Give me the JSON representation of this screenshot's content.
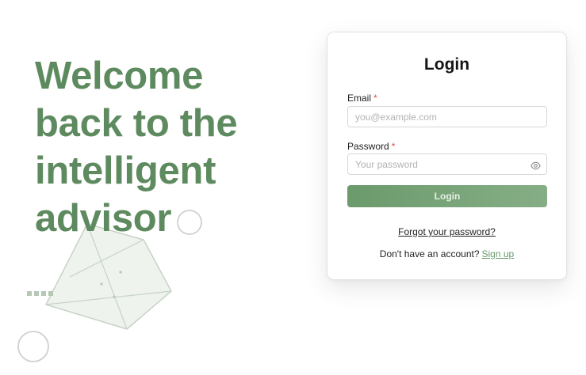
{
  "hero": {
    "lines": [
      "Welcome",
      "back to the",
      "intelligent",
      "advisor"
    ]
  },
  "login_card": {
    "title": "Login",
    "email": {
      "label": "Email",
      "required_mark": "*",
      "placeholder": "you@example.com",
      "value": ""
    },
    "password": {
      "label": "Password",
      "required_mark": "*",
      "placeholder": "Your password",
      "value": "",
      "toggle_icon": "eye-icon"
    },
    "submit_label": "Login",
    "forgot_password_label": "Forgot your password?",
    "signup_prompt": "Don't have an account?",
    "signup_label": "Sign up"
  },
  "colors": {
    "accent": "#5e8a5f",
    "button_gradient_start": "#6b9a6c",
    "button_gradient_end": "#86ae86",
    "required": "#d9534f",
    "decoration_stroke": "#c7d3c6"
  }
}
